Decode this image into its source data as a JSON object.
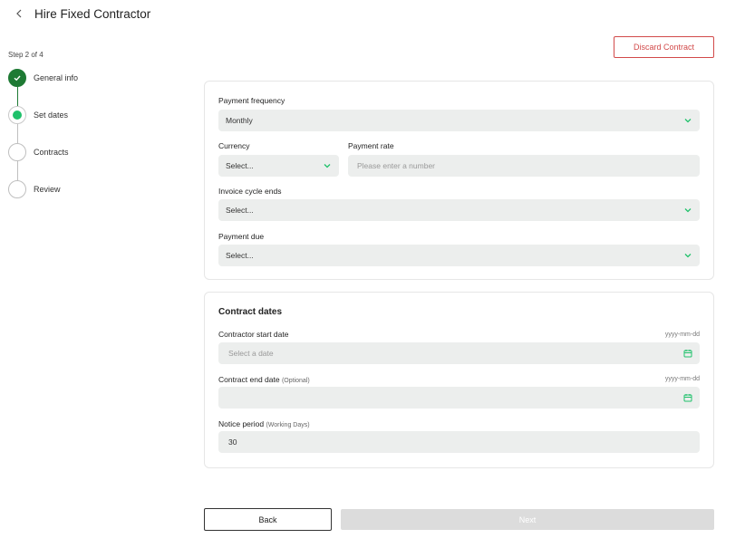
{
  "header": {
    "title": "Hire Fixed Contractor"
  },
  "actions": {
    "discard_label": "Discard Contract"
  },
  "stepper": {
    "step_count": "Step 2 of 4",
    "steps": [
      {
        "label": "General info",
        "state": "done"
      },
      {
        "label": "Set dates",
        "state": "current"
      },
      {
        "label": "Contracts",
        "state": "pending"
      },
      {
        "label": "Review",
        "state": "pending"
      }
    ]
  },
  "payment": {
    "frequency": {
      "label": "Payment frequency",
      "value": "Monthly"
    },
    "currency": {
      "label": "Currency",
      "value": "Select..."
    },
    "rate": {
      "label": "Payment rate",
      "placeholder": "Please enter a number"
    },
    "invoice_cycle": {
      "label": "Invoice cycle ends",
      "value": "Select..."
    },
    "due": {
      "label": "Payment due",
      "value": "Select..."
    }
  },
  "contract_dates": {
    "title": "Contract dates",
    "start": {
      "label": "Contractor start date",
      "hint": "yyyy-mm-dd",
      "placeholder": "Select a date"
    },
    "end": {
      "label": "Contract end date",
      "optional": "(Optional)",
      "hint": "yyyy-mm-dd",
      "value": ""
    },
    "notice": {
      "label": "Notice period",
      "optional": "(Working Days)",
      "value": "30"
    }
  },
  "footer": {
    "back_label": "Back",
    "next_label": "Next"
  },
  "colors": {
    "accent": "#1fc16b",
    "done": "#1e7a34",
    "danger": "#d24a4a"
  }
}
